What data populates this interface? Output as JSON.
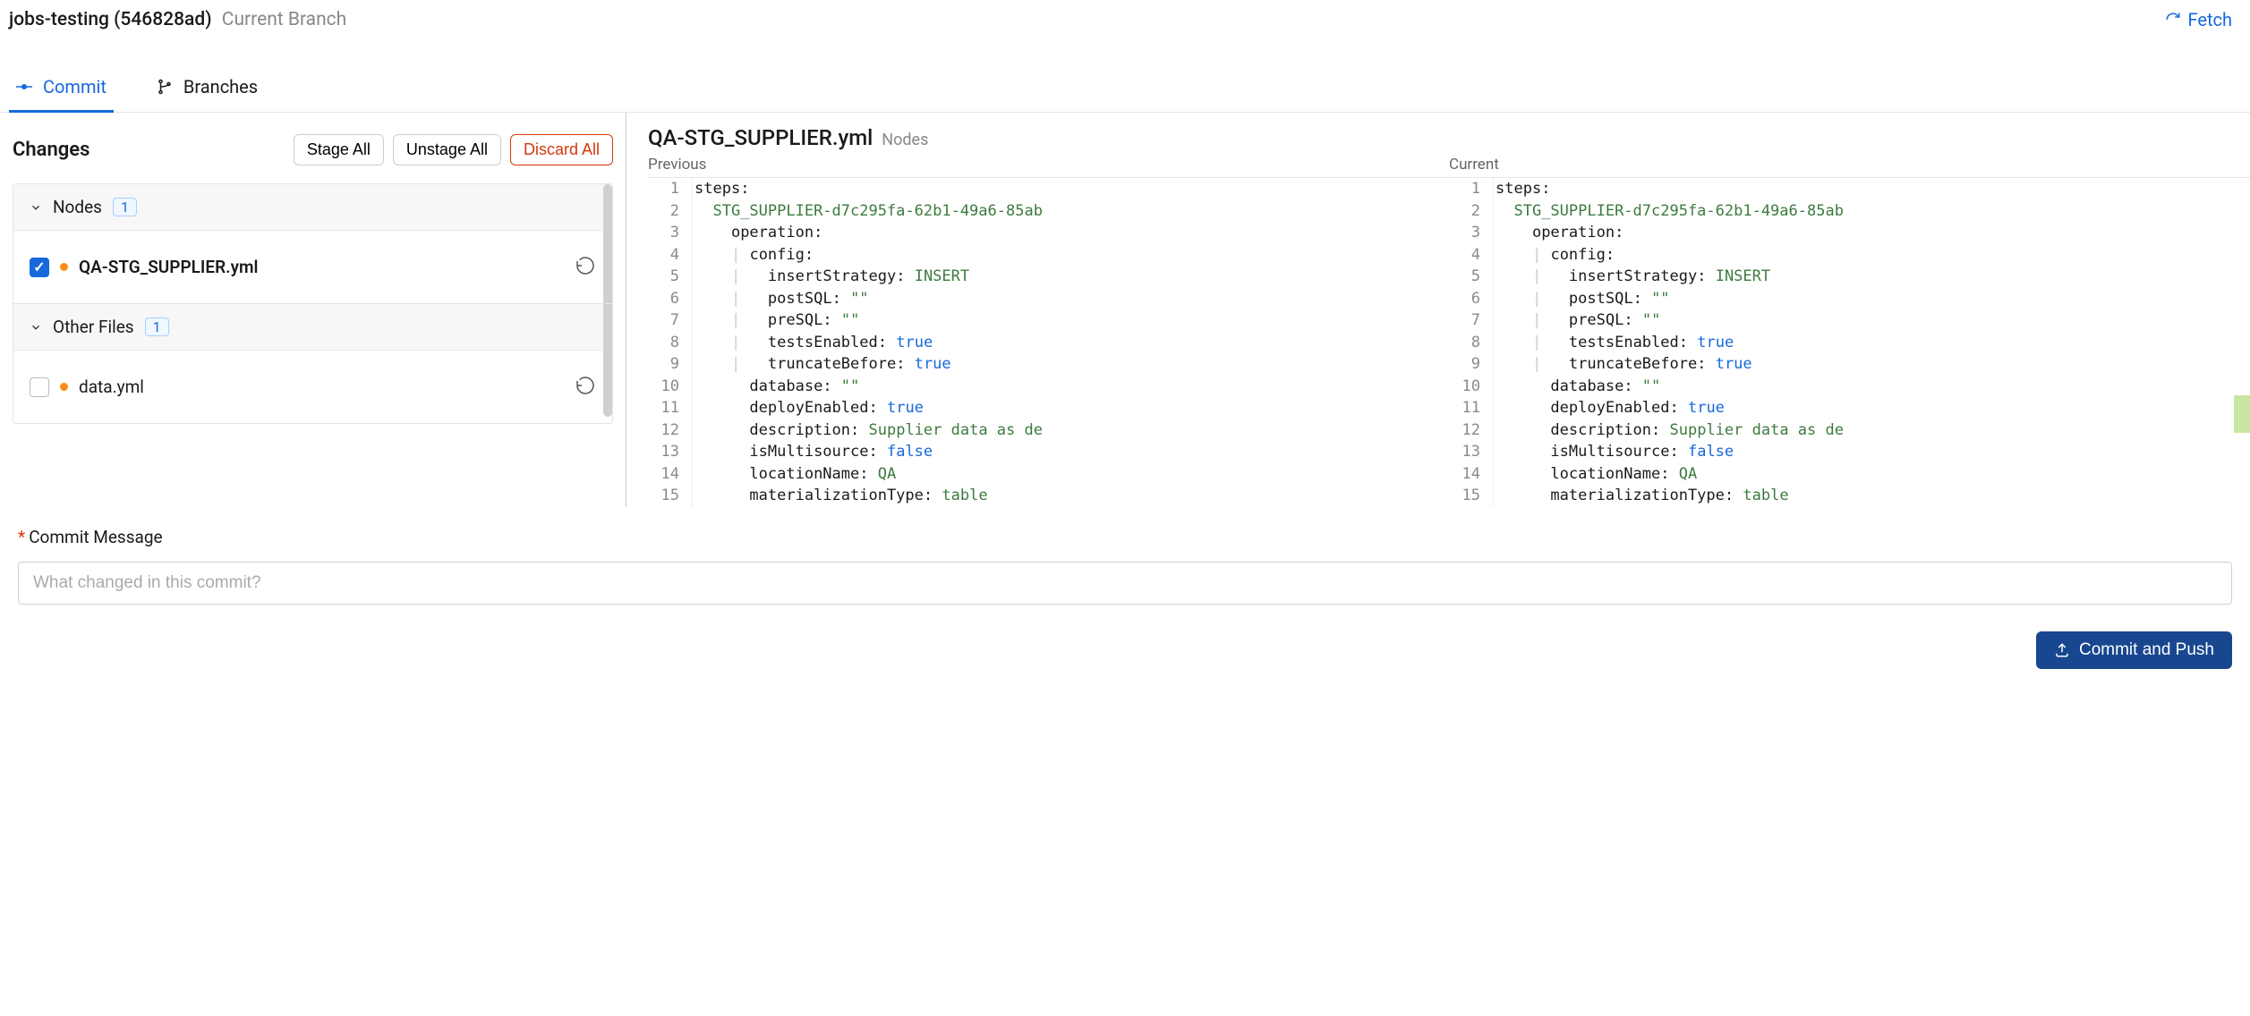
{
  "header": {
    "branch_name": "jobs-testing",
    "branch_hash": "(546828ad)",
    "branch_label": "Current Branch",
    "fetch_label": "Fetch"
  },
  "tabs": {
    "commit": "Commit",
    "branches": "Branches"
  },
  "changes": {
    "title": "Changes",
    "stage_all": "Stage All",
    "unstage_all": "Unstage All",
    "discard_all": "Discard All",
    "groups": [
      {
        "name": "Nodes",
        "count": "1"
      },
      {
        "name": "Other Files",
        "count": "1"
      }
    ],
    "files": [
      {
        "name": "QA-STG_SUPPLIER.yml",
        "checked": true,
        "bold": true
      },
      {
        "name": "data.yml",
        "checked": false,
        "bold": false
      }
    ]
  },
  "diff": {
    "filename": "QA-STG_SUPPLIER.yml",
    "subtitle": "Nodes",
    "previous_label": "Previous",
    "current_label": "Current",
    "lines": [
      {
        "n": 1,
        "tokens": [
          {
            "t": "steps",
            "c": "key"
          },
          {
            "t": ":",
            "c": "key"
          }
        ]
      },
      {
        "n": 2,
        "tokens": [
          {
            "t": "  ",
            "c": ""
          },
          {
            "t": "STG_SUPPLIER-d7c295fa-62b1-49a6-85ab",
            "c": "str"
          }
        ]
      },
      {
        "n": 3,
        "tokens": [
          {
            "t": "    ",
            "c": ""
          },
          {
            "t": "operation",
            "c": "key"
          },
          {
            "t": ":",
            "c": "key"
          }
        ]
      },
      {
        "n": 4,
        "tokens": [
          {
            "t": "    ",
            "c": ""
          },
          {
            "t": "|",
            "c": "pipe"
          },
          {
            "t": " ",
            "c": ""
          },
          {
            "t": "config",
            "c": "key"
          },
          {
            "t": ":",
            "c": "key"
          }
        ]
      },
      {
        "n": 5,
        "tokens": [
          {
            "t": "    ",
            "c": ""
          },
          {
            "t": "|",
            "c": "pipe"
          },
          {
            "t": "   ",
            "c": ""
          },
          {
            "t": "insertStrategy",
            "c": "key"
          },
          {
            "t": ": ",
            "c": "key"
          },
          {
            "t": "INSERT",
            "c": "str"
          }
        ]
      },
      {
        "n": 6,
        "tokens": [
          {
            "t": "    ",
            "c": ""
          },
          {
            "t": "|",
            "c": "pipe"
          },
          {
            "t": "   ",
            "c": ""
          },
          {
            "t": "postSQL",
            "c": "key"
          },
          {
            "t": ": ",
            "c": "key"
          },
          {
            "t": "\"\"",
            "c": "str"
          }
        ]
      },
      {
        "n": 7,
        "tokens": [
          {
            "t": "    ",
            "c": ""
          },
          {
            "t": "|",
            "c": "pipe"
          },
          {
            "t": "   ",
            "c": ""
          },
          {
            "t": "preSQL",
            "c": "key"
          },
          {
            "t": ": ",
            "c": "key"
          },
          {
            "t": "\"\"",
            "c": "str"
          }
        ]
      },
      {
        "n": 8,
        "tokens": [
          {
            "t": "    ",
            "c": ""
          },
          {
            "t": "|",
            "c": "pipe"
          },
          {
            "t": "   ",
            "c": ""
          },
          {
            "t": "testsEnabled",
            "c": "key"
          },
          {
            "t": ": ",
            "c": "key"
          },
          {
            "t": "true",
            "c": "bool"
          }
        ]
      },
      {
        "n": 9,
        "tokens": [
          {
            "t": "    ",
            "c": ""
          },
          {
            "t": "|",
            "c": "pipe"
          },
          {
            "t": "   ",
            "c": ""
          },
          {
            "t": "truncateBefore",
            "c": "key"
          },
          {
            "t": ": ",
            "c": "key"
          },
          {
            "t": "true",
            "c": "bool"
          }
        ]
      },
      {
        "n": 10,
        "tokens": [
          {
            "t": "      ",
            "c": ""
          },
          {
            "t": "database",
            "c": "key"
          },
          {
            "t": ": ",
            "c": "key"
          },
          {
            "t": "\"\"",
            "c": "str"
          }
        ]
      },
      {
        "n": 11,
        "tokens": [
          {
            "t": "      ",
            "c": ""
          },
          {
            "t": "deployEnabled",
            "c": "key"
          },
          {
            "t": ": ",
            "c": "key"
          },
          {
            "t": "true",
            "c": "bool"
          }
        ]
      },
      {
        "n": 12,
        "tokens": [
          {
            "t": "      ",
            "c": ""
          },
          {
            "t": "description",
            "c": "key"
          },
          {
            "t": ": ",
            "c": "key"
          },
          {
            "t": "Supplier data as de",
            "c": "str"
          }
        ]
      },
      {
        "n": 13,
        "tokens": [
          {
            "t": "      ",
            "c": ""
          },
          {
            "t": "isMultisource",
            "c": "key"
          },
          {
            "t": ": ",
            "c": "key"
          },
          {
            "t": "false",
            "c": "bool"
          }
        ]
      },
      {
        "n": 14,
        "tokens": [
          {
            "t": "      ",
            "c": ""
          },
          {
            "t": "locationName",
            "c": "key"
          },
          {
            "t": ": ",
            "c": "key"
          },
          {
            "t": "QA",
            "c": "str"
          }
        ]
      },
      {
        "n": 15,
        "tokens": [
          {
            "t": "      ",
            "c": ""
          },
          {
            "t": "materializationType",
            "c": "key"
          },
          {
            "t": ": ",
            "c": "key"
          },
          {
            "t": "table",
            "c": "str"
          }
        ]
      }
    ]
  },
  "commit": {
    "label": "Commit Message",
    "placeholder": "What changed in this commit?",
    "push_label": "Commit and Push"
  }
}
